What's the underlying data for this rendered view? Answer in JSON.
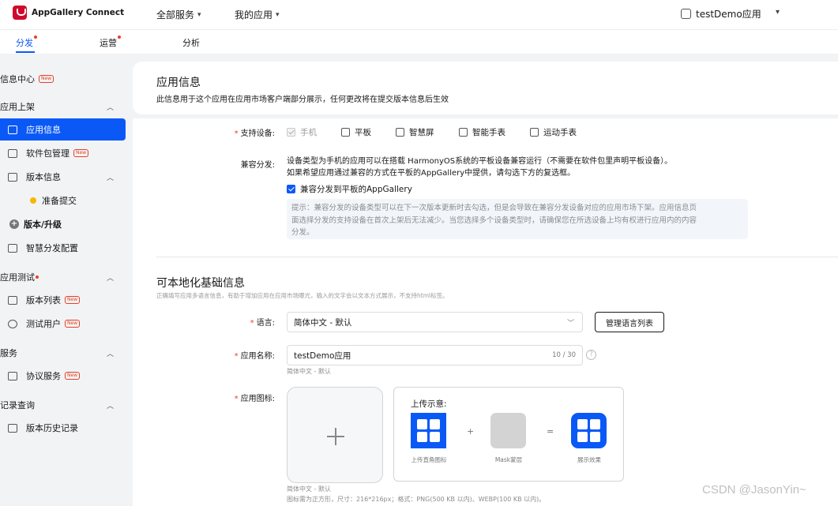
{
  "header": {
    "logo_text": "AppGallery Connect",
    "nav_all_services": "全部服务",
    "nav_my_apps": "我的应用",
    "current_app": "testDemo应用"
  },
  "subtabs": [
    {
      "label": "分发",
      "active": true,
      "dot": true
    },
    {
      "label": "运营",
      "active": false,
      "dot": true
    },
    {
      "label": "分析",
      "active": false,
      "dot": false
    }
  ],
  "sidebar": {
    "info_center": "信息中心",
    "info_center_badge": "New",
    "group_publish": "应用上架",
    "item_app_info": "应用信息",
    "item_package": "软件包管理",
    "item_package_badge": "New",
    "item_version_info": "版本信息",
    "item_prepare": "准备提交",
    "item_upgrade": "版本/升级",
    "item_smart": "智慧分发配置",
    "group_test": "应用测试",
    "item_version_list": "版本列表",
    "item_version_list_badge": "New",
    "item_test_users": "测试用户",
    "item_test_users_badge": "New",
    "group_service": "服务",
    "item_agreement": "协议服务",
    "item_agreement_badge": "New",
    "group_records": "记录查询",
    "item_history": "版本历史记录"
  },
  "app_info": {
    "title": "应用信息",
    "description": "此信息用于这个应用在应用市场客户端部分展示，任何更改将在提交版本信息后生效"
  },
  "devices": {
    "label": "支持设备:",
    "options": [
      "手机",
      "平板",
      "智慧屏",
      "智能手表",
      "运动手表"
    ]
  },
  "compat": {
    "label": "兼容分发:",
    "line1": "设备类型为手机的应用可以在搭载 HarmonyOS系统的平板设备兼容运行（不需要在软件包里声明平板设备）。",
    "line2": "如果希望应用通过兼容的方式在平板的AppGallery中提供，请勾选下方的复选框。",
    "checkbox_label": "兼容分发到平板的AppGallery",
    "checked": true,
    "tip_line1": "提示：兼容分发的设备类型可以在下一次版本更新时去勾选，但是会导致在兼容分发设备对应的应用市场下架。应用信息页",
    "tip_line2": "面选择分发的支持设备在首次上架后无法减少。当您选择多个设备类型时，请确保您在所选设备上均有权进行应用内的内容",
    "tip_line3": "分发。"
  },
  "localization": {
    "title": "可本地化基础信息",
    "description": "正确填写应用多语言信息，有助于增加应用在应用市场曝光，输入的文字会以文本方式展示，不支持html标签。",
    "language_label": "语言:",
    "language_value": "简体中文 - 默认",
    "manage_button": "管理语言列表",
    "name_label": "应用名称:",
    "name_value": "testDemo应用",
    "name_counter": "10 / 30",
    "name_hint": "简体中文 - 默认",
    "icon_label": "应用图标:",
    "icon_hint1": "简体中文 - 默认",
    "icon_hint2": "图标需为正方形，尺寸：216*216px；格式：PNG(500 KB 以内)、WEBP(100 KB 以内)。",
    "demo_title": "上传示意:",
    "demo_cap1": "上传直角图标",
    "demo_cap2": "Mask蒙层",
    "demo_cap3": "展示效果",
    "op_plus": "+",
    "op_equals": "="
  },
  "watermark": "CSDN @JasonYin~",
  "colors": {
    "accent": "#0a59f7",
    "brand": "#cf0a2c",
    "alert": "#e84026"
  }
}
